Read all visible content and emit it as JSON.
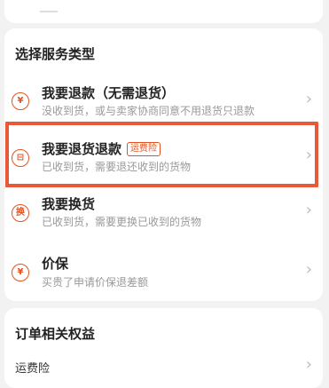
{
  "service_section": {
    "title": "选择服务类型",
    "options": [
      {
        "icon": "yen-icon",
        "icon_glyph": "¥",
        "title": "我要退款（无需退货）",
        "subtitle": "没收到货，或与卖家协商同意不用退货只退款"
      },
      {
        "icon": "return-box-icon",
        "icon_glyph": "⊟",
        "title": "我要退货退款",
        "badge": "运费险",
        "subtitle": "已收到货，需要退还收到的货物"
      },
      {
        "icon": "exchange-icon",
        "icon_glyph": "换",
        "title": "我要换货",
        "subtitle": "已收到货，需要更换已收到的货物"
      },
      {
        "icon": "price-protect-icon",
        "icon_glyph": "¥",
        "title": "价保",
        "subtitle": "买贵了申请价保退差额"
      }
    ]
  },
  "rights_section": {
    "title": "订单相关权益",
    "first_item": "运费险"
  },
  "colors": {
    "accent": "#e2531f",
    "highlight_border": "#e8593a",
    "background": "#f2f2f2"
  }
}
